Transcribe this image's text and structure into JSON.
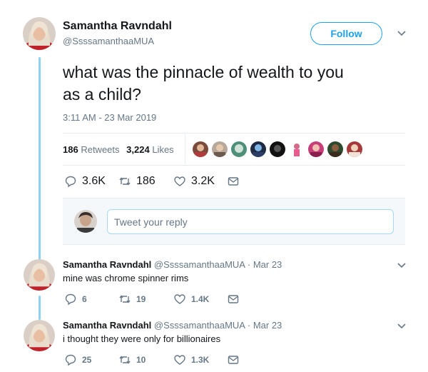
{
  "main_tweet": {
    "author_name": "Samantha Ravndahl",
    "author_handle": "@SsssamanthaaMUA",
    "follow_label": "Follow",
    "text": "what was the pinnacle of wealth to you as a child?",
    "timestamp": "3:11 AM - 23 Mar 2019",
    "retweets_count": "186",
    "retweets_label": "Retweets",
    "likes_count": "3,224",
    "likes_label": "Likes",
    "actions": {
      "replies": "3.6K",
      "retweets": "186",
      "likes": "3.2K"
    }
  },
  "reply_composer": {
    "placeholder": "Tweet your reply"
  },
  "replies": [
    {
      "author_name": "Samantha Ravndahl",
      "author_handle": "@SsssamanthaaMUA",
      "meta": "· Mar 23",
      "text": "mine was chrome spinner rims",
      "actions": {
        "replies": "6",
        "retweets": "19",
        "likes": "1.4K"
      }
    },
    {
      "author_name": "Samantha Ravndahl",
      "author_handle": "@SsssamanthaaMUA",
      "meta": "· Mar 23",
      "text": "i thought they were only for billionaires",
      "actions": {
        "replies": "25",
        "retweets": "10",
        "likes": "1.3K"
      }
    }
  ],
  "colors": {
    "accent": "#1da1f2",
    "secondary_text": "#657786",
    "thread_line": "#8fd0f5"
  }
}
